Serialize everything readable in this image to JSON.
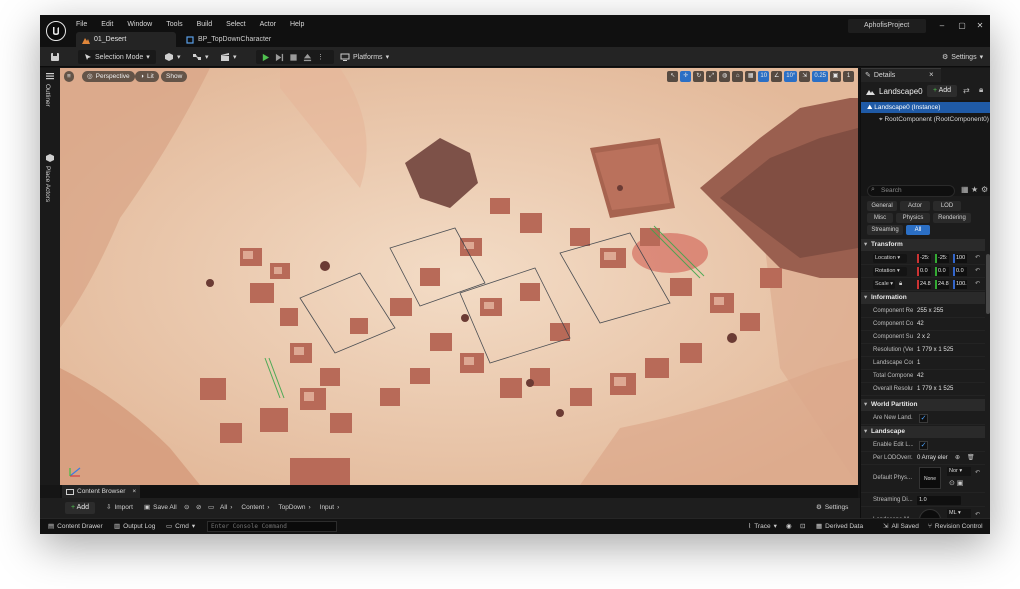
{
  "window": {
    "project": "AphofisProject",
    "menu": [
      "File",
      "Edit",
      "Window",
      "Tools",
      "Build",
      "Select",
      "Actor",
      "Help"
    ],
    "level_tab": "01_Desert",
    "blueprint_tab": "BP_TopDownCharacter",
    "minimize": "–",
    "maximize": "▢",
    "close": "✕"
  },
  "toolbar": {
    "selection_mode": "Selection Mode",
    "platforms": "Platforms",
    "settings": "Settings"
  },
  "left_rail": {
    "outliner": "Outliner",
    "place_actors": "Place Actors"
  },
  "viewport": {
    "perspective": "Perspective",
    "lit": "Lit",
    "show": "Show",
    "grid_snap": "10",
    "angle_snap": "10°",
    "scale_snap": "0.25",
    "camera_speed": "1"
  },
  "details": {
    "tab": "Details",
    "object_name": "Landscape0",
    "add": "Add",
    "tree": {
      "root": "Landscape0 (Instance)",
      "child": "RootComponent (RootComponent0)"
    },
    "search_placeholder": "Search",
    "filters": [
      "General",
      "Actor",
      "LOD",
      "Misc",
      "Physics",
      "Rendering",
      "Streaming",
      "All"
    ],
    "transform": {
      "title": "Transform",
      "location_label": "Location",
      "rotation_label": "Rotation",
      "scale_label": "Scale",
      "location": [
        "-25:",
        "-25:",
        "100"
      ],
      "rotation": [
        "0.0 °",
        "0.0 °",
        "0.0 °"
      ],
      "scale": [
        "24.8",
        "24.8",
        "100."
      ]
    },
    "information": {
      "title": "Information",
      "rows": [
        {
          "k": "Component Res",
          "v": "255 x 255"
        },
        {
          "k": "Component Cou",
          "v": "42"
        },
        {
          "k": "Component Sub",
          "v": "2 x 2"
        },
        {
          "k": "Resolution (Ver",
          "v": "1 779 x 1 525"
        },
        {
          "k": "Landscape Cou",
          "v": "1"
        },
        {
          "k": "Total Compone",
          "v": "42"
        },
        {
          "k": "Overall Resolut",
          "v": "1 779 x 1 525"
        }
      ]
    },
    "world_partition": {
      "title": "World Partition",
      "are_new": "Are New Land..."
    },
    "landscape": {
      "title": "Landscape",
      "enable_edit": "Enable Edit L...",
      "per_lod": "Per LODOverr...",
      "per_lod_value": "0 Array eler",
      "default_phys": "Default Phys...",
      "none_thumb": "None",
      "none_drop": "Nor",
      "streaming": "Streaming Di...",
      "streaming_value": "1.0",
      "landscape_m": "Landscape M...",
      "ml_drop": "ML"
    }
  },
  "content_browser": {
    "tab": "Content Browser",
    "add": "Add",
    "import": "Import",
    "save_all": "Save All",
    "breadcrumb": [
      "All",
      "Content",
      "TopDown",
      "Input"
    ],
    "settings": "Settings"
  },
  "statusbar": {
    "content_drawer": "Content Drawer",
    "output_log": "Output Log",
    "cmd": "Cmd",
    "console_placeholder": "Enter Console Command",
    "trace": "Trace",
    "derived_data": "Derived Data",
    "all_saved": "All Saved",
    "revision_control": "Revision Control"
  },
  "colors": {
    "accent": "#2b6fc5",
    "sand": "#e8c4a6",
    "rock": "#b8614e"
  }
}
